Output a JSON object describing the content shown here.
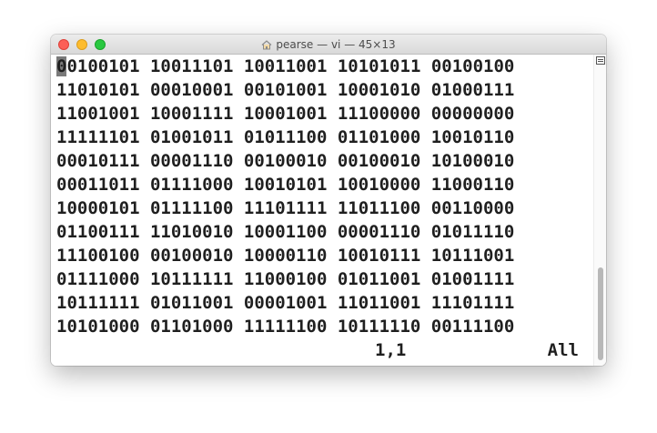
{
  "window": {
    "title": "pearse — vi — 45×13"
  },
  "icons": {
    "home": "home-icon",
    "scroll_toggle": "scrollbar-toggle-icon"
  },
  "colors": {
    "close": "#fc5f57",
    "minimize": "#fdbc2e",
    "maximize": "#29c840",
    "cursor": "#7a7a7a"
  },
  "editor": {
    "cursor_char": "0",
    "first_line_rest": "0100101 10011101 10011001 10101011 00100100",
    "lines": [
      "11010101 00010001 00101001 10001010 01000111",
      "11001001 10001111 10001001 11100000 00000000",
      "11111101 01001011 01011100 01101000 10010110",
      "00010111 00001110 00100010 00100010 10100010",
      "00011011 01111000 10010101 10010000 11000110",
      "10000101 01111100 11101111 11011100 00110000",
      "01100111 11010010 10001100 00001110 01011110",
      "11100100 00100010 10000110 10010111 10111001",
      "01111000 10111111 11000100 01011001 01001111",
      "10111111 01011001 00001001 11011001 11101111",
      "10101000 01101000 11111100 10111110 00111100"
    ],
    "status": {
      "position": "1,1",
      "scroll": "All"
    }
  }
}
